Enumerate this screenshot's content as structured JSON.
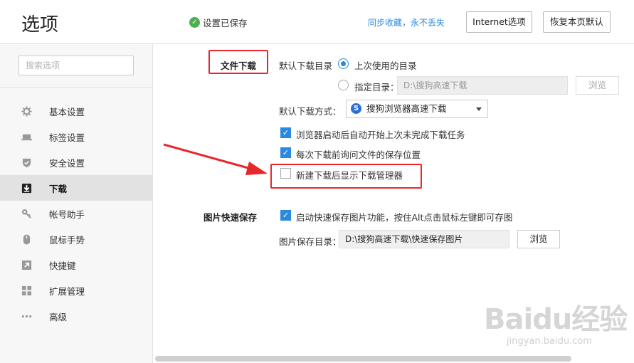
{
  "header": {
    "title": "选项",
    "saved_text": "设置已保存",
    "sync_text": "同步收藏，永不丢失",
    "internet_btn": "Internet选项",
    "reset_btn": "恢复本页默认"
  },
  "sidebar": {
    "search_placeholder": "搜索选项",
    "items": [
      {
        "label": "基本设置",
        "icon": "gear-icon"
      },
      {
        "label": "标签设置",
        "icon": "tab-icon"
      },
      {
        "label": "安全设置",
        "icon": "shield-icon"
      },
      {
        "label": "下载",
        "icon": "download-icon",
        "active": true
      },
      {
        "label": "帐号助手",
        "icon": "key-icon"
      },
      {
        "label": "鼠标手势",
        "icon": "mouse-icon"
      },
      {
        "label": "快捷键",
        "icon": "shortcut-icon"
      },
      {
        "label": "扩展管理",
        "icon": "extensions-icon"
      },
      {
        "label": "高级",
        "icon": "more-icon"
      }
    ]
  },
  "download": {
    "section_label": "文件下载",
    "dir_label": "默认下载目录",
    "radio_last_label": "上次使用的目录",
    "radio_specified_label": "指定目录：",
    "specified_path": "D:\\搜狗高速下载",
    "browse_label": "浏览",
    "method_label": "默认下载方式：",
    "method_value": "搜狗浏览器高速下载",
    "checkbox_resume": "浏览器启动后自动开始上次未完成下载任务",
    "checkbox_ask": "每次下载前询问文件的保存位置",
    "checkbox_show_manager": "新建下载后显示下载管理器"
  },
  "quicksave": {
    "section_label": "图片快速保存",
    "checkbox_enable": "启动快速保存图片功能，按住Alt点击鼠标左键即可存图",
    "dir_label": "图片保存目录：",
    "dir_value": "D:\\搜狗高速下载\\快速保存图片",
    "browse_label": "浏览"
  },
  "watermark": {
    "brand": "Baidu经验",
    "url": "jingyan.baidu.com"
  },
  "colors": {
    "accent": "#2b8ae0",
    "annotation_red": "#e8272c",
    "saved_green": "#4caf50"
  }
}
